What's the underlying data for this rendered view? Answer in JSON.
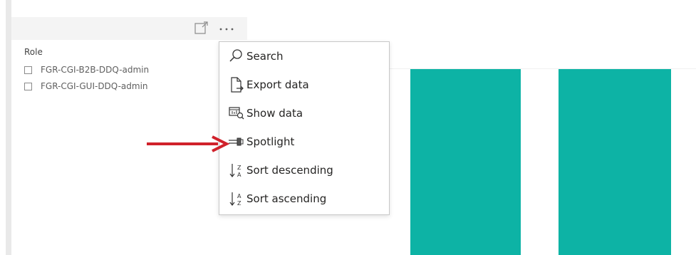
{
  "slicer": {
    "title": "Role",
    "items": [
      {
        "label": "FGR-CGI-B2B-DDQ-admin",
        "checked": false
      },
      {
        "label": "FGR-CGI-GUI-DDQ-admin",
        "checked": false
      }
    ],
    "header_icons": [
      "focus-mode-icon",
      "more-options-icon"
    ]
  },
  "context_menu": {
    "items": [
      {
        "label": "Search",
        "icon": "search-icon"
      },
      {
        "label": "Export data",
        "icon": "export-data-icon"
      },
      {
        "label": "Show data",
        "icon": "show-data-icon"
      },
      {
        "label": "Spotlight",
        "icon": "spotlight-icon"
      },
      {
        "label": "Sort descending",
        "icon": "sort-descending-icon"
      },
      {
        "label": "Sort ascending",
        "icon": "sort-ascending-icon"
      }
    ],
    "highlighted_item": "Spotlight"
  },
  "colors": {
    "bar": "#0db3a5",
    "annotation_arrow": "#d0212b",
    "menu_text": "#252423"
  }
}
